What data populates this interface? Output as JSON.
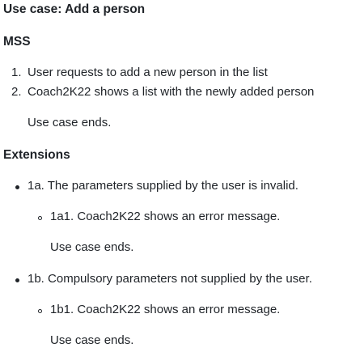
{
  "title": "Use case: Add a person",
  "mss": {
    "heading": "MSS",
    "steps": [
      {
        "number": "1.",
        "text": "User requests to add a new person in the list"
      },
      {
        "number": "2.",
        "text": "Coach2K22 shows a list with the newly added person"
      }
    ],
    "ending": "Use case ends."
  },
  "extensions": {
    "heading": "Extensions",
    "items": [
      {
        "text": "1a. The parameters supplied by the user is invalid.",
        "sub": {
          "text": "1a1. Coach2K22 shows an error message.",
          "ending": "Use case ends."
        }
      },
      {
        "text": "1b. Compulsory parameters not supplied by the user.",
        "sub": {
          "text": "1b1. Coach2K22 shows an error message.",
          "ending": "Use case ends."
        }
      }
    ]
  }
}
